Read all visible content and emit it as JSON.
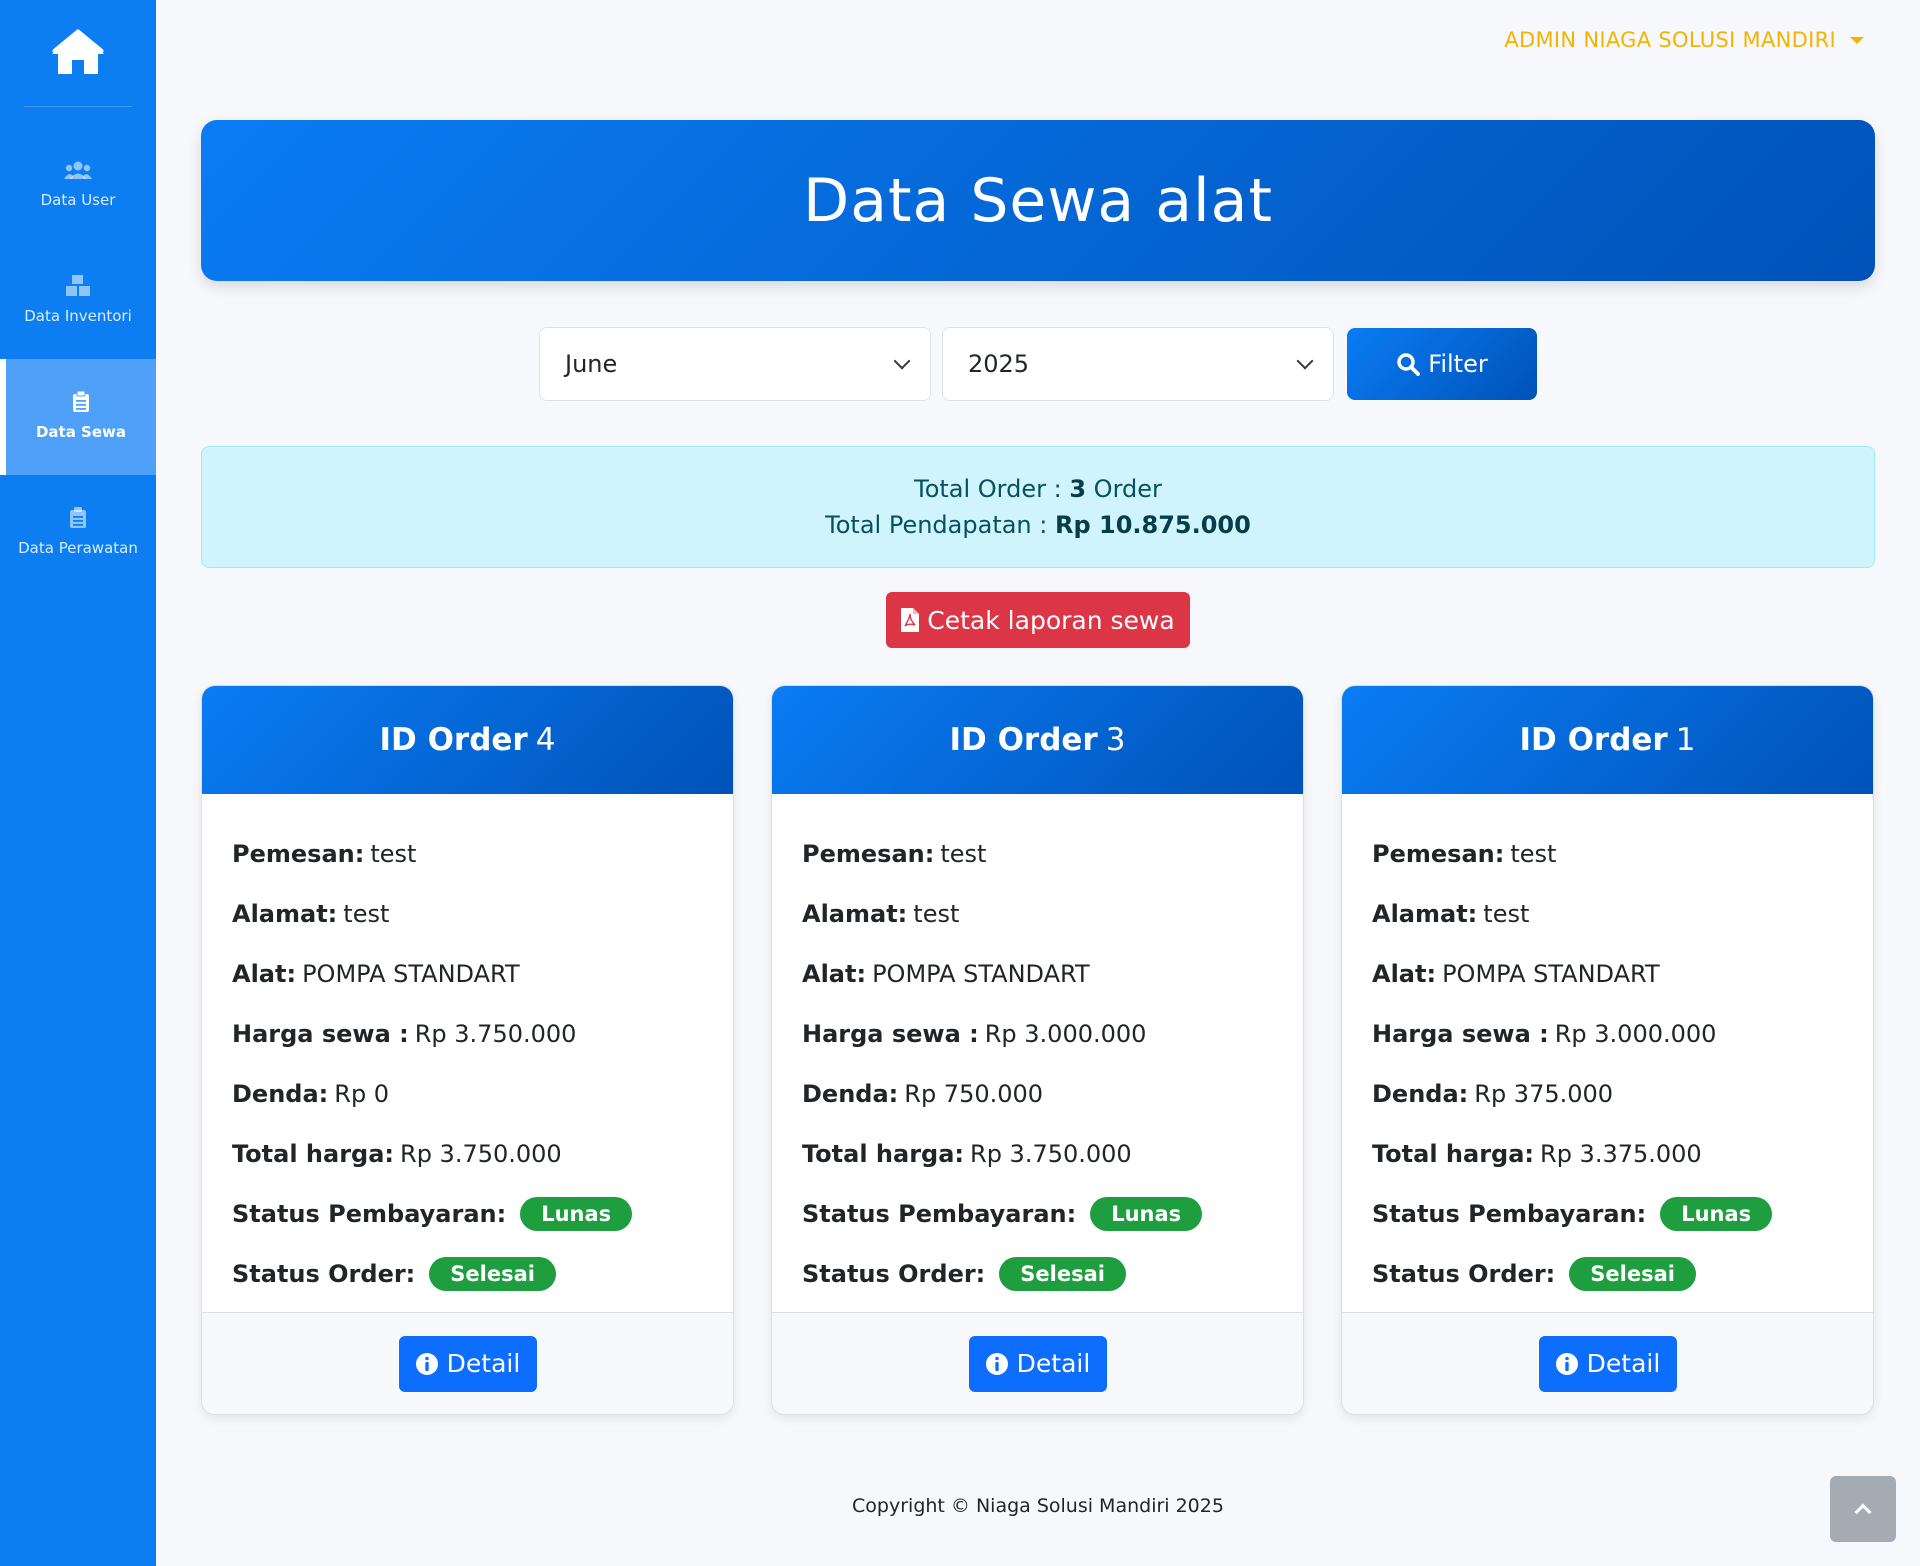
{
  "sidebar": {
    "items": [
      {
        "label": "Data User",
        "icon": "users-icon"
      },
      {
        "label": "Data Inventori",
        "icon": "boxes-icon"
      },
      {
        "label": "Data Sewa",
        "icon": "clipboard-icon",
        "active": true
      },
      {
        "label": "Data Perawatan",
        "icon": "clipboard-icon"
      }
    ]
  },
  "header": {
    "user": "ADMIN NIAGA SOLUSI MANDIRI"
  },
  "hero": {
    "title": "Data Sewa alat"
  },
  "filter": {
    "month": "June",
    "year": "2025",
    "button": "Filter"
  },
  "summary": {
    "order_label": "Total Order : ",
    "order_count": "3",
    "order_unit": " Order",
    "income_label": "Total Pendapatan : ",
    "income_value": "Rp 10.875.000"
  },
  "print_button": "Cetak laporan sewa",
  "labels": {
    "id_order": "ID Order",
    "pemesan": "Pemesan:",
    "alamat": "Alamat:",
    "alat": "Alat:",
    "harga": "Harga sewa :",
    "denda": "Denda:",
    "total": "Total harga:",
    "status_bayar": "Status Pembayaran:",
    "status_order": "Status Order:",
    "detail": "Detail"
  },
  "orders": [
    {
      "id": "4",
      "pemesan": "test",
      "alamat": "test",
      "alat": "POMPA STANDART",
      "harga": "Rp 3.750.000",
      "denda": "Rp 0",
      "total": "Rp 3.750.000",
      "status_bayar": "Lunas",
      "status_order": "Selesai"
    },
    {
      "id": "3",
      "pemesan": "test",
      "alamat": "test",
      "alat": "POMPA STANDART",
      "harga": "Rp 3.000.000",
      "denda": "Rp 750.000",
      "total": "Rp 3.750.000",
      "status_bayar": "Lunas",
      "status_order": "Selesai"
    },
    {
      "id": "1",
      "pemesan": "test",
      "alamat": "test",
      "alat": "POMPA STANDART",
      "harga": "Rp 3.000.000",
      "denda": "Rp 375.000",
      "total": "Rp 3.375.000",
      "status_bayar": "Lunas",
      "status_order": "Selesai"
    }
  ],
  "footer": "Copyright © Niaga Solusi Mandiri 2025",
  "colors": {
    "primary": "#0d7ef2",
    "accent": "#f2b400",
    "danger": "#dc3545",
    "success": "#1e9e3e"
  }
}
